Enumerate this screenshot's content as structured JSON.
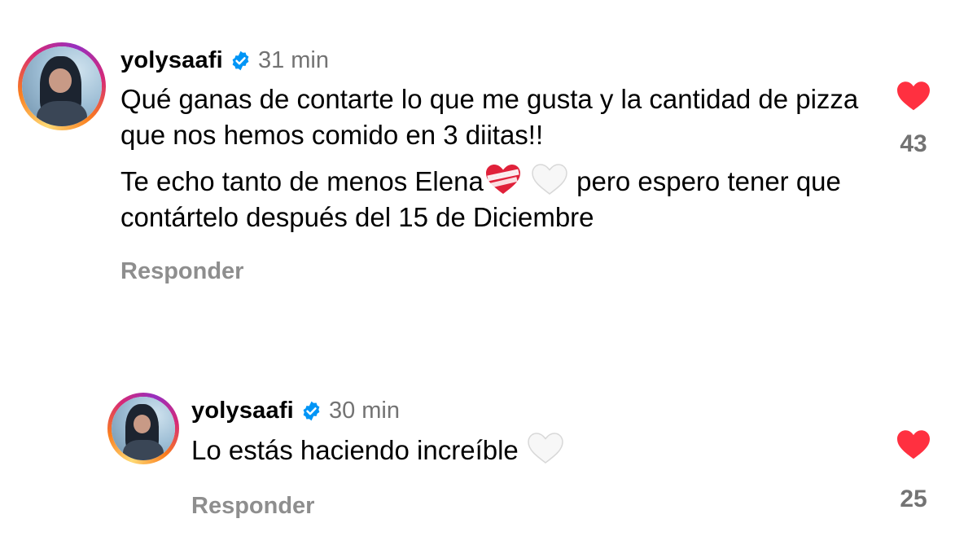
{
  "comments": [
    {
      "username": "yolysaafi",
      "time": "31 min",
      "paragraph1": "Qué ganas de contarte lo que me gusta y la cantidad de pizza que nos hemos comido en 3 diitas!!",
      "paragraph2_a": "Te echo tanto de menos Elena",
      "paragraph2_b": " pero espero tener que contártelo después del 15 de Diciembre",
      "reply_label": "Responder",
      "likes": "43"
    },
    {
      "username": "yolysaafi",
      "time": "30 min",
      "paragraph1": "Lo estás haciendo increíble ",
      "reply_label": "Responder",
      "likes": "25"
    }
  ],
  "colors": {
    "heart": "#ff3040",
    "verified": "#0095f6",
    "muted": "#737373",
    "reply": "#8e8e8e"
  },
  "icons": {
    "verified": "verified-badge-icon",
    "like": "heart-filled-icon",
    "emoji_mending_heart": "mending-heart-emoji",
    "emoji_white_heart": "white-heart-emoji"
  }
}
